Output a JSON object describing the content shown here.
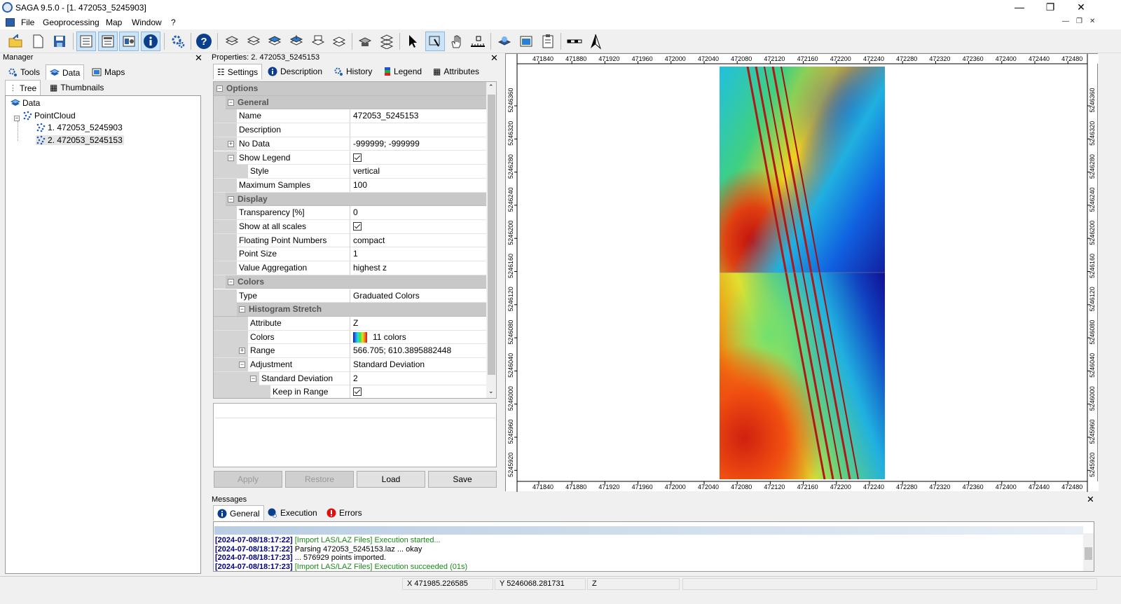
{
  "window": {
    "title": "SAGA 9.5.0 - [1. 472053_5245903]",
    "minimize": "—",
    "maximize": "❐",
    "close": "✕"
  },
  "menu": {
    "items": [
      "File",
      "Geoprocessing",
      "Map",
      "Window",
      "?"
    ]
  },
  "manager": {
    "title": "Manager",
    "tabs": [
      "Tools",
      "Data",
      "Maps"
    ],
    "subtabs": [
      "Tree",
      "Thumbnails"
    ],
    "tree": {
      "root": "Data",
      "group": "PointCloud",
      "items": [
        "1. 472053_5245903",
        "2. 472053_5245153"
      ]
    }
  },
  "properties": {
    "title": "Properties:  2. 472053_5245153",
    "tabs": [
      "Settings",
      "Description",
      "History",
      "Legend",
      "Attributes"
    ],
    "rows": [
      {
        "key": "Options",
        "value": ""
      },
      {
        "key": "General",
        "value": ""
      },
      {
        "key": "Name",
        "value": "472053_5245153"
      },
      {
        "key": "Description",
        "value": ""
      },
      {
        "key": "No Data",
        "value": "-999999; -999999"
      },
      {
        "key": "Show Legend",
        "value": ""
      },
      {
        "key": "Style",
        "value": "vertical"
      },
      {
        "key": "Maximum Samples",
        "value": "100"
      },
      {
        "key": "Display",
        "value": ""
      },
      {
        "key": "Transparency [%]",
        "value": "0"
      },
      {
        "key": "Show at all scales",
        "value": ""
      },
      {
        "key": "Floating Point Numbers",
        "value": "compact"
      },
      {
        "key": "Point Size",
        "value": "1"
      },
      {
        "key": "Value Aggregation",
        "value": "highest z"
      },
      {
        "key": "Colors",
        "value": ""
      },
      {
        "key": "Type",
        "value": "Graduated Colors"
      },
      {
        "key": "Histogram Stretch",
        "value": ""
      },
      {
        "key": "Attribute",
        "value": "Z"
      },
      {
        "key": "Colors",
        "value": "11 colors"
      },
      {
        "key": "Range",
        "value": "566.705; 610.3895882448"
      },
      {
        "key": "Adjustment",
        "value": "Standard Deviation"
      },
      {
        "key": "Standard Deviation",
        "value": "2"
      },
      {
        "key": "Keep in Range",
        "value": ""
      }
    ],
    "buttons": {
      "apply": "Apply",
      "restore": "Restore",
      "load": "Load",
      "save": "Save"
    }
  },
  "map": {
    "x_ticks": [
      "471840",
      "471880",
      "471920",
      "471960",
      "472000",
      "472040",
      "472080",
      "472120",
      "472160",
      "472200",
      "472240",
      "472280",
      "472320",
      "472360",
      "472400",
      "472440",
      "472480"
    ],
    "y_ticks": [
      "5246360",
      "5246320",
      "5246280",
      "5246240",
      "5246200",
      "5246160",
      "5246120",
      "5246080",
      "5246040",
      "5246000",
      "5245960",
      "5245920"
    ]
  },
  "messages": {
    "title": "Messages",
    "tabs": [
      "General",
      "Execution",
      "Errors"
    ],
    "lines": [
      {
        "ts": "[2024-07-08/18:17:22]",
        "text": " [Import LAS/LAZ Files] Execution started...",
        "green": true
      },
      {
        "ts": "[2024-07-08/18:17:22]",
        "text": " Parsing 472053_5245153.laz ... okay",
        "green": false
      },
      {
        "ts": "[2024-07-08/18:17:23]",
        "text": " ... 576929 points imported.",
        "green": false
      },
      {
        "ts": "[2024-07-08/18:17:23]",
        "text": " [Import LAS/LAZ Files] Execution succeeded (01s)",
        "green": true
      }
    ]
  },
  "status": {
    "x": "X 471985.226585",
    "y": "Y 5246068.281731",
    "z": "Z"
  }
}
